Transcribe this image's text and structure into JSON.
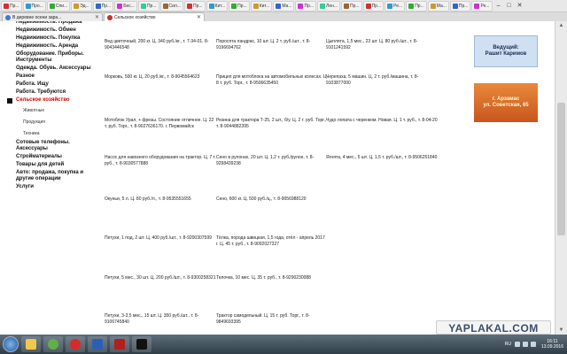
{
  "browser": {
    "bookmarks": [
      "Пр...",
      "Про...",
      "Спи...",
      "Эд...",
      "Пр...",
      "Бес...",
      "Пр...",
      "Сил...",
      "Пр...",
      "Кит...",
      "Пр...",
      "Кит...",
      "Ма...",
      "Пр...",
      "Лен...",
      "Пр...",
      "Пр...",
      "Ре...",
      "Пр...",
      "Ма...",
      "Пр...",
      "Ре..."
    ],
    "tabs": [
      {
        "label": "В деревне осени зара...",
        "active": false
      },
      {
        "label": "Сельское хозяйство",
        "active": true
      }
    ]
  },
  "sidebar": {
    "items": [
      {
        "label": "Недвижимость. Продажа",
        "type": "item"
      },
      {
        "label": "Недвижимость. Обмен",
        "type": "item"
      },
      {
        "label": "Недвижимость. Покупка",
        "type": "item"
      },
      {
        "label": "Недвижимость. Аренда",
        "type": "item"
      },
      {
        "label": "Оборудование. Приборы. Инструменты",
        "type": "item"
      },
      {
        "label": "Одежда. Обувь. Аксессуары",
        "type": "item"
      },
      {
        "label": "Разное",
        "type": "item"
      },
      {
        "label": "Работа. Ищу",
        "type": "item"
      },
      {
        "label": "Работа. Требуются",
        "type": "item"
      },
      {
        "label": "Сельское хозяйство",
        "type": "active"
      },
      {
        "label": "Животные",
        "type": "sub"
      },
      {
        "label": "Продукция",
        "type": "sub"
      },
      {
        "label": "Техника",
        "type": "sub"
      },
      {
        "label": "Сотовые телефоны. Аксессуары",
        "type": "item"
      },
      {
        "label": "Стройматериалы",
        "type": "item"
      },
      {
        "label": "Товары для детей",
        "type": "item"
      },
      {
        "label": "Авто: продажа, покупка и другие операции",
        "type": "item"
      },
      {
        "label": "Услуги",
        "type": "item"
      }
    ]
  },
  "listings": [
    [
      "Вед цветочный, 200 кг. Ц. 340 руб./кг., т. 7-34-01. 8-9043446548",
      "Поросята ландрас, 10 шт. Ц. 2 т. руб./шт., т. 8-9196694762",
      "Цыплята, 1,5 мес., 23 шт. Ц. 80 руб./шт., т. 8-9101241592"
    ],
    [
      "Морковь, 500 кг. Ц. 20 руб./кг., т. 8-9045564623",
      "Прицеп для мотоблока на автомобильных колесах. Ц. 8 т. руб. Торг., т. 8-9506635450",
      "Черепаха, 5 машин. Ц. 2 т. руб./машина, т. 8-9103877000"
    ],
    [
      "Мотоблок Урал, + фрезы. Состояние отличное. Ц. 22 т. руб. Торг., т. 8-9027636170. г. Первомайск",
      "Резина для трактора Т-25, 2 шт., б/у. Ц. 2 т. руб. Торг., т. 8-9044882395",
      "Чудо лопата с черенком. Новая. Ц. 1 т. руб., т. 8-04-20"
    ],
    [
      "Насос для навозного оборудования на трактор. Ц. 7 т. руб., т. 8-9030577888",
      "Сено в рулонах, 20 шт. Ц. 1,2 т. руб./рулон, т. 8-9298439238",
      "Ягнята, 4 мес., 5 шт. Ц. 1,5 т. руб./шт., т. 8-9506251840"
    ],
    [
      "Окуньи, 5 л. Ц. 80 руб./л., т. 8-9535551655",
      "Сено, 600 кг. Ц. 500 руб./ц., т. 8-9056988120",
      ""
    ],
    [
      "Петухи, 1 под, 2 шт. Ц. 400 руб./шт., т. 8-9200307599",
      "Тёлка, порода швицкая, 1,5 года, отёл - апрель 2017 г. Ц. 45 т. руб., т. 8-9092027327",
      ""
    ],
    [
      "Петухи, 5 мес., 30 шт. Ц. 200 руб./шт., т. 8-9300258321",
      "Телочка, 10 мес. Ц. 35 т. руб., т. 8-9290230088",
      ""
    ],
    [
      "Петухи, 3-3,5 мес., 15 шт. Ц. 350 руб./шт., т. 8-9106745840",
      "Трактор самодельный. Ц. 15 т. руб. Торг., т. 8-9849693395",
      ""
    ]
  ],
  "banners": {
    "blue": [
      "Ведущий:",
      "Рашит Каримов"
    ],
    "orange": [
      "г. Арзамас",
      "ул. Советская, 65"
    ]
  },
  "watermark": "YAPLAKAL.COM",
  "taskbar": {
    "lang": "RU",
    "time": "16:11",
    "date": "13.09.2016"
  },
  "colors": {
    "active_category": "#d00000",
    "banner_blue": "#cfe0f3",
    "banner_orange": "#e8893a"
  }
}
